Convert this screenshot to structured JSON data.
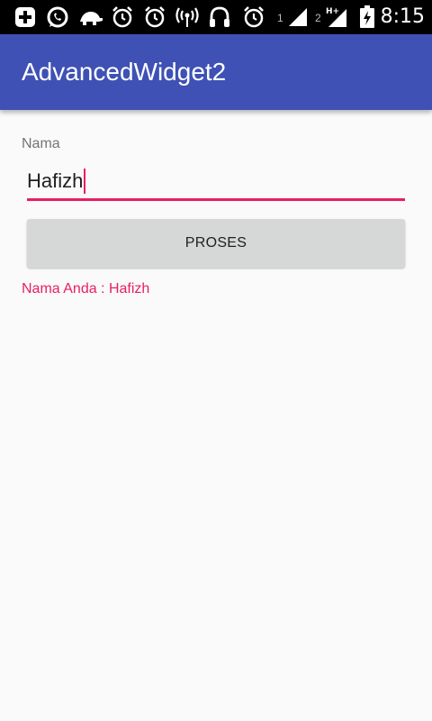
{
  "status_bar": {
    "time": "8:15",
    "sim1": "1",
    "sim2": "2",
    "icons": [
      "add-box-icon",
      "whatsapp-icon",
      "turtle-icon",
      "alarm-icon",
      "alarm-icon",
      "wifi-hotspot-icon",
      "headphones-icon",
      "alarm-icon",
      "signal-icon",
      "signal-h-plus-icon",
      "battery-charging-icon"
    ]
  },
  "app_bar": {
    "title": "AdvancedWidget2",
    "color": "#3f51b5"
  },
  "form": {
    "label": "Nama",
    "input_value": "Hafizh",
    "button_label": "PROSES",
    "result": "Nama Anda : Hafizh",
    "accent_color": "#e91e63"
  }
}
